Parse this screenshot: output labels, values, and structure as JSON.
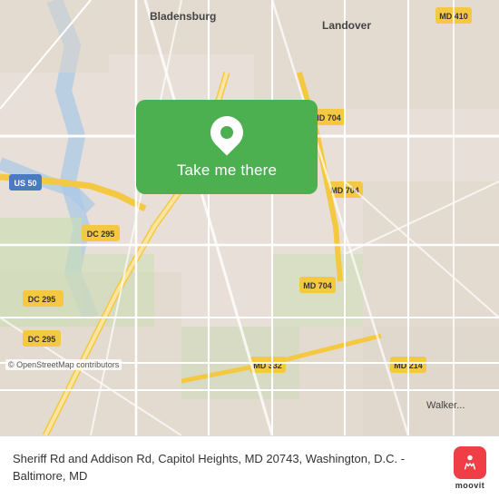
{
  "map": {
    "attribution": "© OpenStreetMap contributors"
  },
  "popup": {
    "label": "Take me there"
  },
  "bottom_bar": {
    "address": "Sheriff Rd and Addison Rd, Capitol Heights, MD 20743, Washington, D.C. - Baltimore, MD"
  },
  "moovit": {
    "name": "moovit"
  },
  "roads": {
    "color_yellow": "#f5c842",
    "color_white": "#ffffff",
    "color_light": "#f0ebe3",
    "color_green": "#4caf50"
  }
}
